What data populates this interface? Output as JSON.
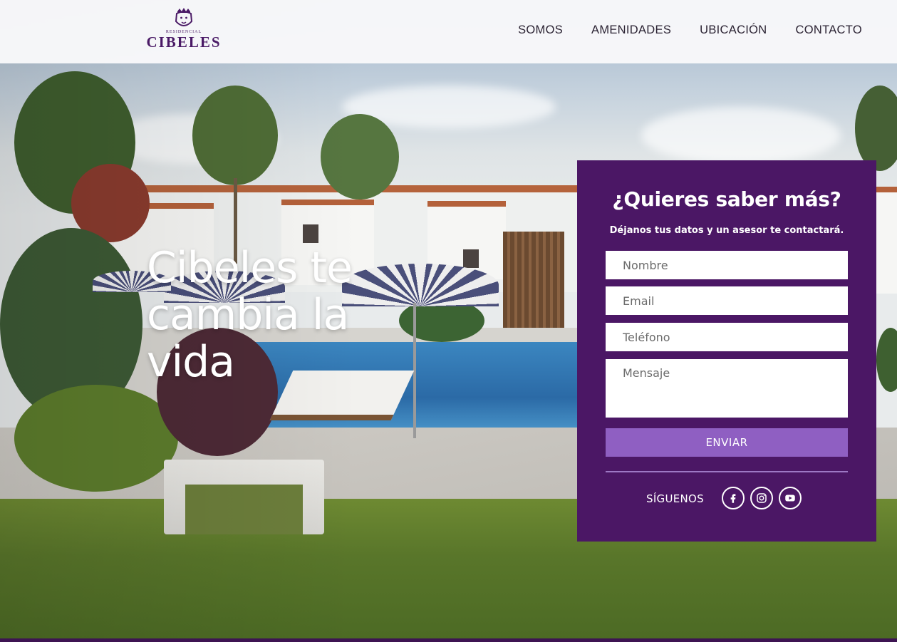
{
  "header": {
    "logo_small": "RESIDENCIAL",
    "logo_big": "CIBELES",
    "nav": [
      {
        "label": "SOMOS"
      },
      {
        "label": "AMENIDADES"
      },
      {
        "label": "UBICACIÓN"
      },
      {
        "label": "CONTACTO"
      }
    ]
  },
  "hero": {
    "headline": "Cibeles te cambia la vida"
  },
  "form": {
    "title": "¿Quieres saber más?",
    "subtitle": "Déjanos tus datos y un asesor te contactará.",
    "name_placeholder": "Nombre",
    "email_placeholder": "Email",
    "phone_placeholder": "Teléfono",
    "message_placeholder": "Mensaje",
    "submit_label": "ENVIAR",
    "follow_label": "SÍGUENOS",
    "social_icons": [
      "facebook-icon",
      "instagram-icon",
      "youtube-icon"
    ]
  },
  "colors": {
    "brand_purple": "#4b1765",
    "button_purple": "#8f5fc2",
    "logo_purple": "#4a1a66"
  }
}
